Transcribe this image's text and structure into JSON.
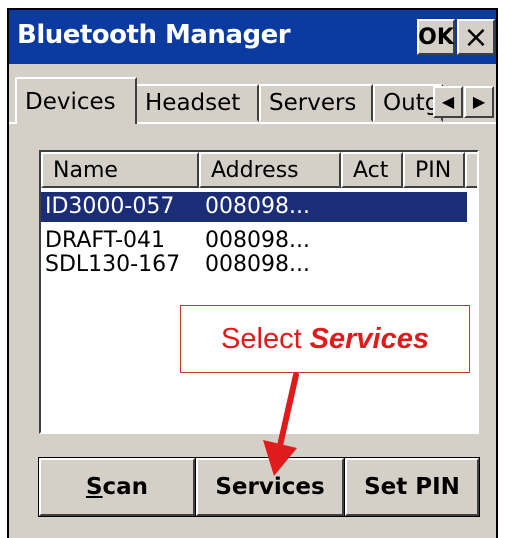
{
  "window": {
    "title": "Bluetooth Manager",
    "ok_label": "OK",
    "close_label": "×"
  },
  "tabs": [
    {
      "label": "Devices"
    },
    {
      "label": "Headset"
    },
    {
      "label": "Servers"
    },
    {
      "label": "Outgo"
    }
  ],
  "tab_scroll": {
    "left": "◀",
    "right": "▶"
  },
  "device_list": {
    "columns": [
      "Name",
      "Address",
      "Act",
      "PIN"
    ],
    "rows": [
      {
        "name": "ID3000-057",
        "address": "008098...",
        "selected": true
      },
      {
        "name": "DRAFT-041",
        "address": "008098...",
        "selected": false
      },
      {
        "name": "SDL130-167",
        "address": "008098...",
        "selected": false
      }
    ]
  },
  "callout": {
    "prefix": "Select",
    "emphasis": "Services",
    "color": "#e01b1b"
  },
  "buttons": {
    "scan_prefix": "S",
    "scan_rest": "can",
    "services": "Services",
    "set_pin": "Set PIN"
  },
  "colors": {
    "titlebar": "#0b3aa0",
    "selection": "#1c2d78",
    "face": "#d4d0c8"
  }
}
